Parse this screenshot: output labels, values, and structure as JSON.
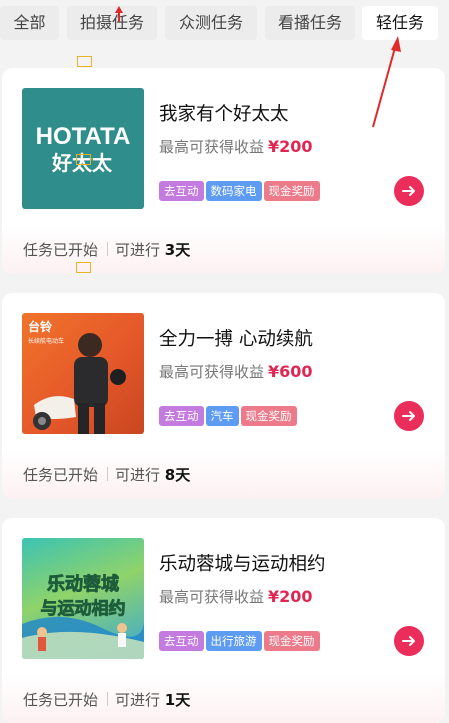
{
  "tabs": [
    {
      "label": "全部",
      "active": false
    },
    {
      "label": "拍摄任务",
      "active": false
    },
    {
      "label": "众测任务",
      "active": false
    },
    {
      "label": "看播任务",
      "active": false
    },
    {
      "label": "轻任务",
      "active": true
    }
  ],
  "cards": [
    {
      "title": "我家有个好太太",
      "earn_label": "最高可获得收益",
      "amount": "¥200",
      "thumb": {
        "line1": "HOTATA",
        "line2": "好太太"
      },
      "tags": [
        {
          "label": "去互动",
          "color": "#c47be0"
        },
        {
          "label": "数码家电",
          "color": "#5d9cf2"
        },
        {
          "label": "现金奖励",
          "color": "#ec7a8b"
        }
      ],
      "status": "任务已开始",
      "duration_prefix": "可进行",
      "duration": "3天"
    },
    {
      "title": "全力一搏 心动续航",
      "earn_label": "最高可获得收益",
      "amount": "¥600",
      "thumb": {
        "brand": "台铃",
        "slogan": "长续航电动车"
      },
      "tags": [
        {
          "label": "去互动",
          "color": "#c47be0"
        },
        {
          "label": "汽车",
          "color": "#5d9cf2"
        },
        {
          "label": "现金奖励",
          "color": "#ec7a8b"
        }
      ],
      "status": "任务已开始",
      "duration_prefix": "可进行",
      "duration": "8天"
    },
    {
      "title": "乐动蓉城与运动相约",
      "earn_label": "最高可获得收益",
      "amount": "¥200",
      "thumb": {
        "line1": "乐动蓉城",
        "line2": "与运动相约"
      },
      "tags": [
        {
          "label": "去互动",
          "color": "#c47be0"
        },
        {
          "label": "出行旅游",
          "color": "#5d9cf2"
        },
        {
          "label": "现金奖励",
          "color": "#ec7a8b"
        }
      ],
      "status": "任务已开始",
      "duration_prefix": "可进行",
      "duration": "1天"
    }
  ],
  "colors": {
    "accent": "#ea2d5a",
    "amount": "#e02652",
    "annotation": "#e02a2a"
  }
}
